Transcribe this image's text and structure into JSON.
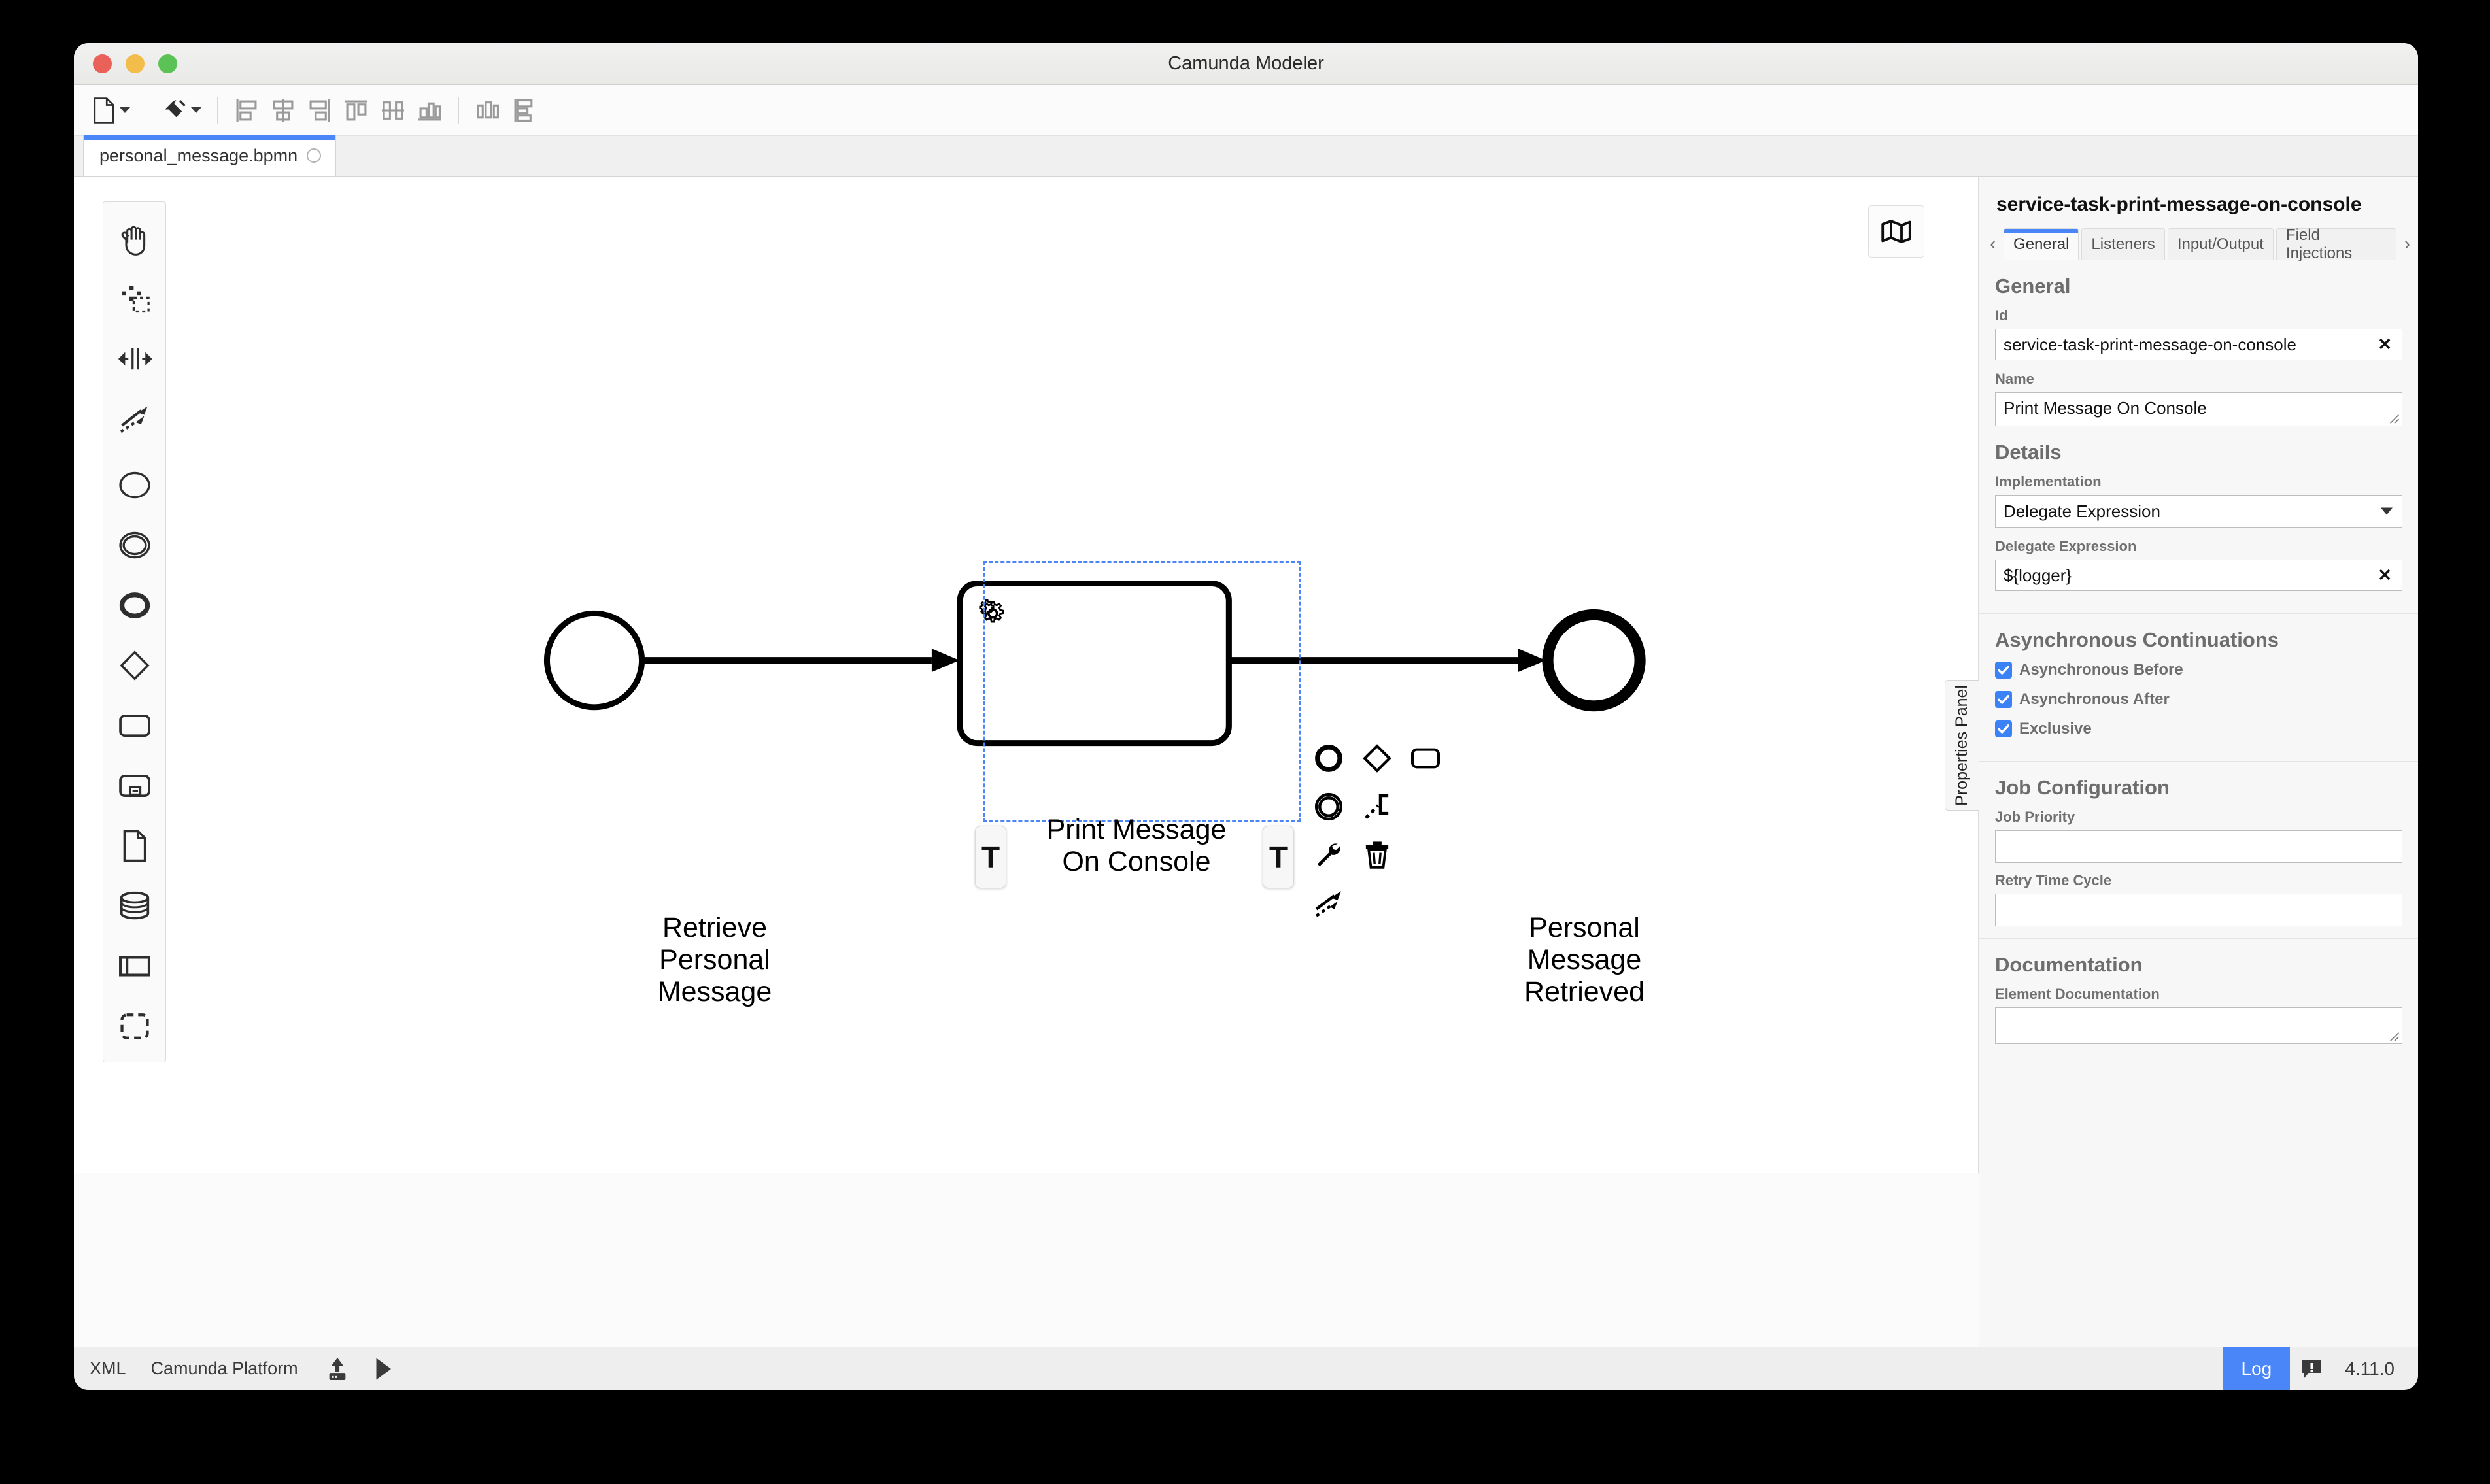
{
  "window": {
    "title": "Camunda Modeler",
    "traffic_lights": [
      "close",
      "minimize",
      "maximize"
    ]
  },
  "toolbar": {
    "items": [
      {
        "name": "new-diagram",
        "icon": "file-icon",
        "has_caret": true
      },
      {
        "name": "align-tool",
        "icon": "paintbrush-icon",
        "has_caret": true
      },
      {
        "name": "align-left",
        "icon": "align-left-icon"
      },
      {
        "name": "align-center-horizontal",
        "icon": "align-center-icon"
      },
      {
        "name": "align-right",
        "icon": "align-right-icon"
      },
      {
        "name": "align-top",
        "icon": "align-top-icon"
      },
      {
        "name": "align-middle",
        "icon": "align-middle-icon"
      },
      {
        "name": "align-bottom",
        "icon": "align-bottom-icon"
      },
      {
        "name": "distribute-horizontal",
        "icon": "distribute-horizontal-icon"
      },
      {
        "name": "distribute-vertical",
        "icon": "distribute-vertical-icon"
      }
    ]
  },
  "file_tab": {
    "label": "personal_message.bpmn",
    "close_icon": "close-circle-icon"
  },
  "palette": {
    "tools": [
      {
        "name": "hand-tool",
        "icon": "hand-icon"
      },
      {
        "name": "lasso-tool",
        "icon": "lasso-icon"
      },
      {
        "name": "space-tool",
        "icon": "space-icon"
      },
      {
        "name": "global-connect-tool",
        "icon": "connect-icon"
      }
    ],
    "elements": [
      {
        "name": "create-start-event",
        "icon": "start-event-icon"
      },
      {
        "name": "create-intermediate-event",
        "icon": "intermediate-event-icon"
      },
      {
        "name": "create-end-event",
        "icon": "end-event-icon"
      },
      {
        "name": "create-gateway",
        "icon": "gateway-icon"
      },
      {
        "name": "create-task",
        "icon": "task-icon"
      },
      {
        "name": "create-subprocess",
        "icon": "subprocess-icon"
      },
      {
        "name": "create-data-object",
        "icon": "data-object-icon"
      },
      {
        "name": "create-data-store",
        "icon": "data-store-icon"
      },
      {
        "name": "create-participant",
        "icon": "participant-icon"
      },
      {
        "name": "create-group",
        "icon": "group-icon"
      }
    ]
  },
  "canvas": {
    "minimap_toggle_icon": "map-icon",
    "elements": {
      "start_event_label": "Retrieve\nPersonal\nMessage",
      "task_label": "Print Message\nOn Console",
      "task_type_icon": "gear-icon",
      "task_async_before_marker": "T",
      "task_async_after_marker": "T",
      "end_event_label": "Personal\nMessage\nRetrieved"
    },
    "context_pad": [
      {
        "name": "append-end-event",
        "icon": "end-event-icon"
      },
      {
        "name": "append-gateway",
        "icon": "gateway-icon"
      },
      {
        "name": "append-task",
        "icon": "task-icon"
      },
      {
        "name": "append-intermediate-event",
        "icon": "intermediate-event-icon"
      },
      {
        "name": "append-text-annotation",
        "icon": "text-annotation-icon"
      },
      {
        "name": "change-element-type",
        "icon": "wrench-icon"
      },
      {
        "name": "delete-element",
        "icon": "trash-icon"
      },
      {
        "name": "connect-element",
        "icon": "connect-icon"
      }
    ],
    "selection_color": "#4a86f7"
  },
  "properties_panel": {
    "side_tab_label": "Properties Panel",
    "element_title": "service-task-print-message-on-console",
    "nav_prev": "‹",
    "nav_next": "›",
    "tabs": [
      {
        "label": "General",
        "active": true
      },
      {
        "label": "Listeners",
        "active": false
      },
      {
        "label": "Input/Output",
        "active": false
      },
      {
        "label": "Field Injections",
        "active": false
      }
    ],
    "active_tab_color": "#4a86f7",
    "groups": {
      "general": {
        "title": "General",
        "id_label": "Id",
        "id_value": "service-task-print-message-on-console",
        "id_clear_icon": "clear-x-icon",
        "name_label": "Name",
        "name_value": "Print Message On Console"
      },
      "details": {
        "title": "Details",
        "implementation_label": "Implementation",
        "implementation_value": "Delegate Expression",
        "delegate_expression_label": "Delegate Expression",
        "delegate_expression_value": "${logger}",
        "delegate_clear_icon": "clear-x-icon"
      },
      "async_continuations": {
        "title": "Asynchronous Continuations",
        "checkboxes": [
          {
            "label": "Asynchronous Before",
            "checked": true
          },
          {
            "label": "Asynchronous After",
            "checked": true
          },
          {
            "label": "Exclusive",
            "checked": true
          }
        ],
        "checkbox_color": "#3b82f6"
      },
      "job_configuration": {
        "title": "Job Configuration",
        "job_priority_label": "Job Priority",
        "job_priority_value": "",
        "retry_time_cycle_label": "Retry Time Cycle",
        "retry_time_cycle_value": ""
      },
      "documentation": {
        "title": "Documentation",
        "element_documentation_label": "Element Documentation",
        "element_documentation_value": ""
      }
    }
  },
  "status_bar": {
    "xml_label": "XML",
    "platform_label": "Camunda Platform",
    "deploy_icon": "deploy-upload-icon",
    "run_icon": "play-icon",
    "log_label": "Log",
    "log_color": "#4a86f7",
    "notifications_icon": "alert-bubble-icon",
    "version": "4.11.0"
  }
}
